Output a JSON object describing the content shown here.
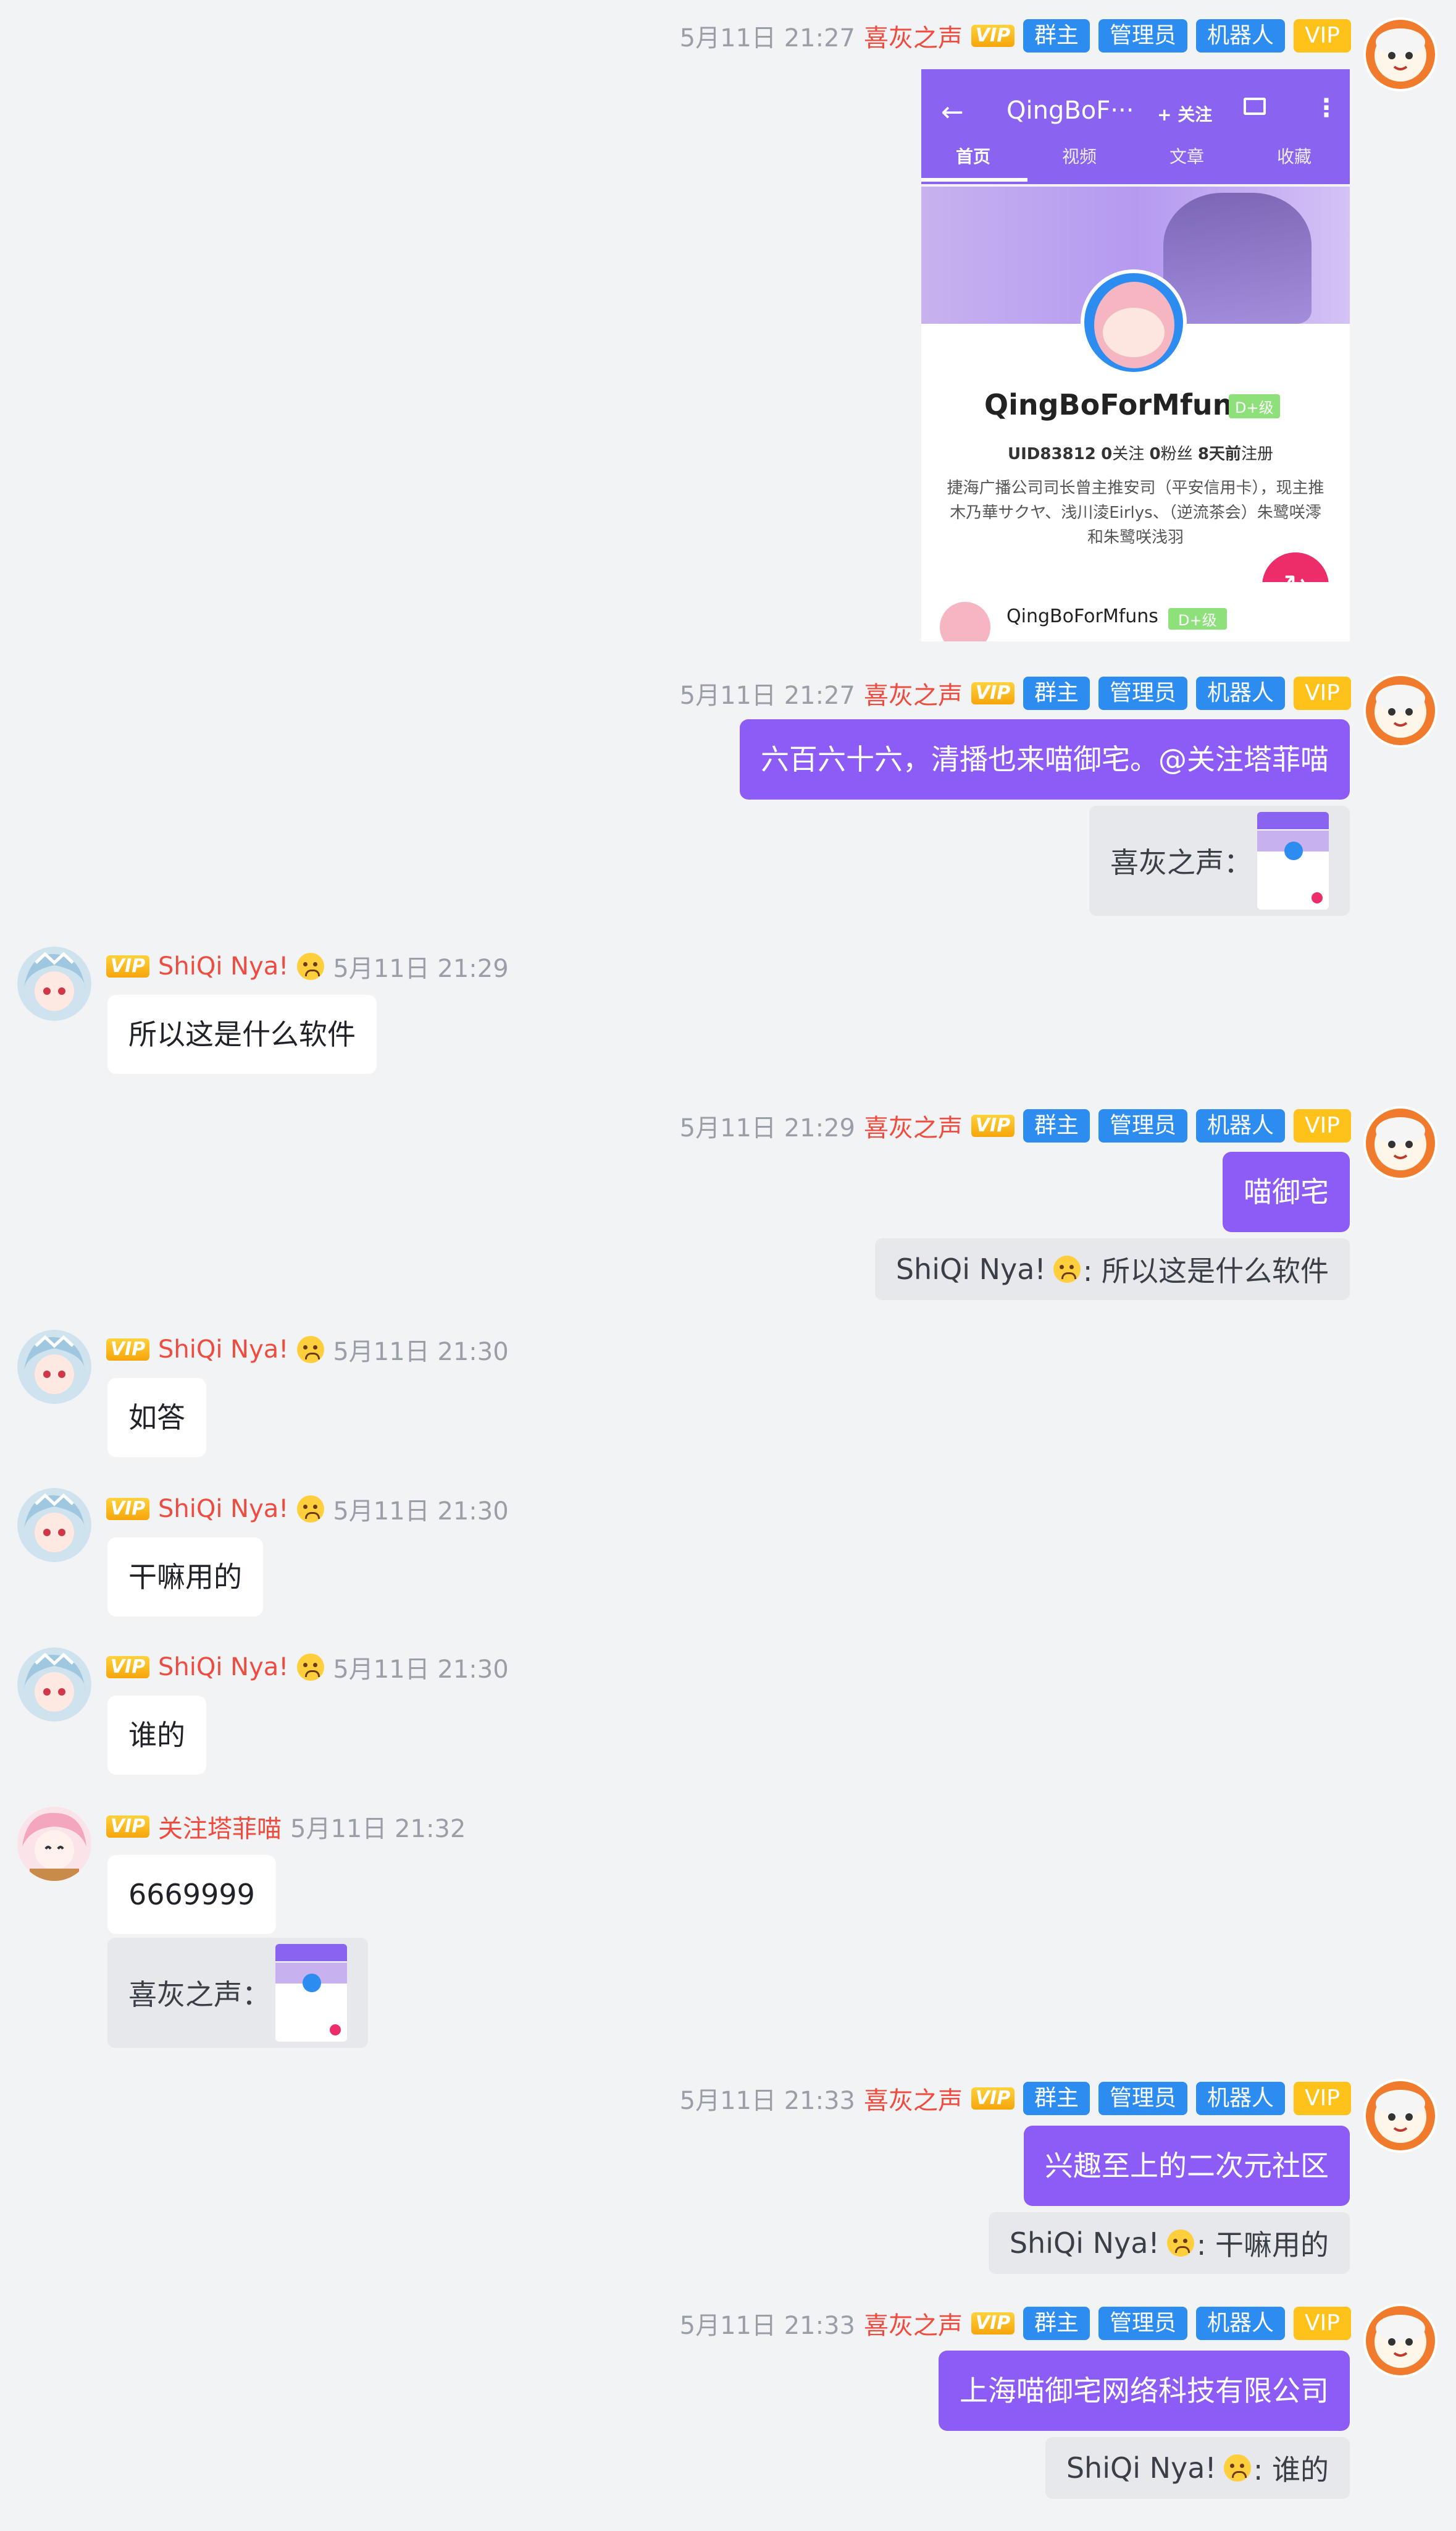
{
  "colors": {
    "background": "#f2f3f5",
    "purple_bubble": "#8d5cf6",
    "nick_red": "#ef4b3f",
    "tag_blue": "#2d8cf0",
    "tag_gold": "#ffc21a"
  },
  "tags": {
    "owner": "群主",
    "admin": "管理员",
    "bot": "机器人",
    "vip": "VIP",
    "vip_icon": "VIP"
  },
  "messages": [
    {
      "time": "5月11日 21:27",
      "sender": "喜灰之声"
    },
    {
      "time": "5月11日 21:27",
      "sender": "喜灰之声",
      "text": "六百六十六，清播也来喵御宅。@关注塔菲喵",
      "quote_prefix": "喜灰之声："
    },
    {
      "time": "5月11日 21:29",
      "sender": "ShiQi Nya!",
      "text": "所以这是什么软件"
    },
    {
      "time": "5月11日 21:29",
      "sender": "喜灰之声",
      "text": "喵御宅",
      "quote_sender": "ShiQi Nya!",
      "quote_text": ": 所以这是什么软件"
    },
    {
      "time": "5月11日 21:30",
      "sender": "ShiQi Nya!",
      "text": "如答"
    },
    {
      "time": "5月11日 21:30",
      "sender": "ShiQi Nya!",
      "text": "干嘛用的"
    },
    {
      "time": "5月11日 21:30",
      "sender": "ShiQi Nya!",
      "text": "谁的"
    },
    {
      "time": "5月11日 21:32",
      "sender": "关注塔菲喵",
      "text": "6669999",
      "quote_prefix": "喜灰之声："
    },
    {
      "time": "5月11日 21:33",
      "sender": "喜灰之声",
      "text": "兴趣至上的二次元社区",
      "quote_sender": "ShiQi Nya!",
      "quote_text": ": 干嘛用的"
    },
    {
      "time": "5月11日 21:33",
      "sender": "喜灰之声",
      "text": "上海喵御宅网络科技有限公司",
      "quote_sender": "ShiQi Nya!",
      "quote_text": ": 谁的"
    }
  ],
  "screenshot": {
    "title": "QingBoF···",
    "follow_button": "+ 关注",
    "tabs": [
      "首页",
      "视频",
      "文章",
      "收藏"
    ],
    "username": "QingBoForMfuns",
    "level": "D+级",
    "stats_uid": "UID83812",
    "stats_following": "0",
    "stats_following_label": "关注",
    "stats_fans": "0",
    "stats_fans_label": "粉丝",
    "stats_registered": "8天前",
    "stats_registered_label": "注册",
    "bio_line1": "捷海广播公司司长曾主推安司（平安信用卡），现主推",
    "bio_line2": "木乃華サクヤ、浅川淩Eirlys、（逆流茶会）朱鹭咲澪",
    "bio_line3": "和朱鹭咲浅羽",
    "card_name": "QingBoForMfuns",
    "card_level": "D+级"
  }
}
